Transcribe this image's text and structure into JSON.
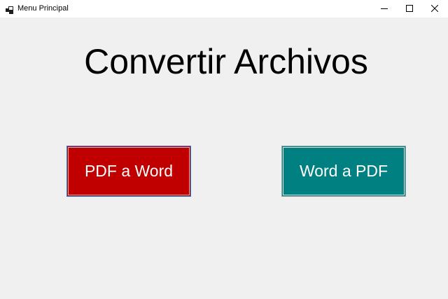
{
  "window": {
    "title": "Menu Principal",
    "app_icon": "windows-form-icon",
    "controls": {
      "minimize_icon": "minimize-icon",
      "maximize_icon": "maximize-icon",
      "close_icon": "close-icon"
    }
  },
  "main": {
    "heading": "Convertir Archivos",
    "buttons": [
      {
        "label": "PDF a Word",
        "color": "#c00000"
      },
      {
        "label": "Word a PDF",
        "color": "#008080"
      }
    ]
  },
  "colors": {
    "background": "#f0f0f0",
    "titlebar": "#ffffff",
    "button_text": "#ffffff",
    "focus_border": "#3c78d8"
  }
}
